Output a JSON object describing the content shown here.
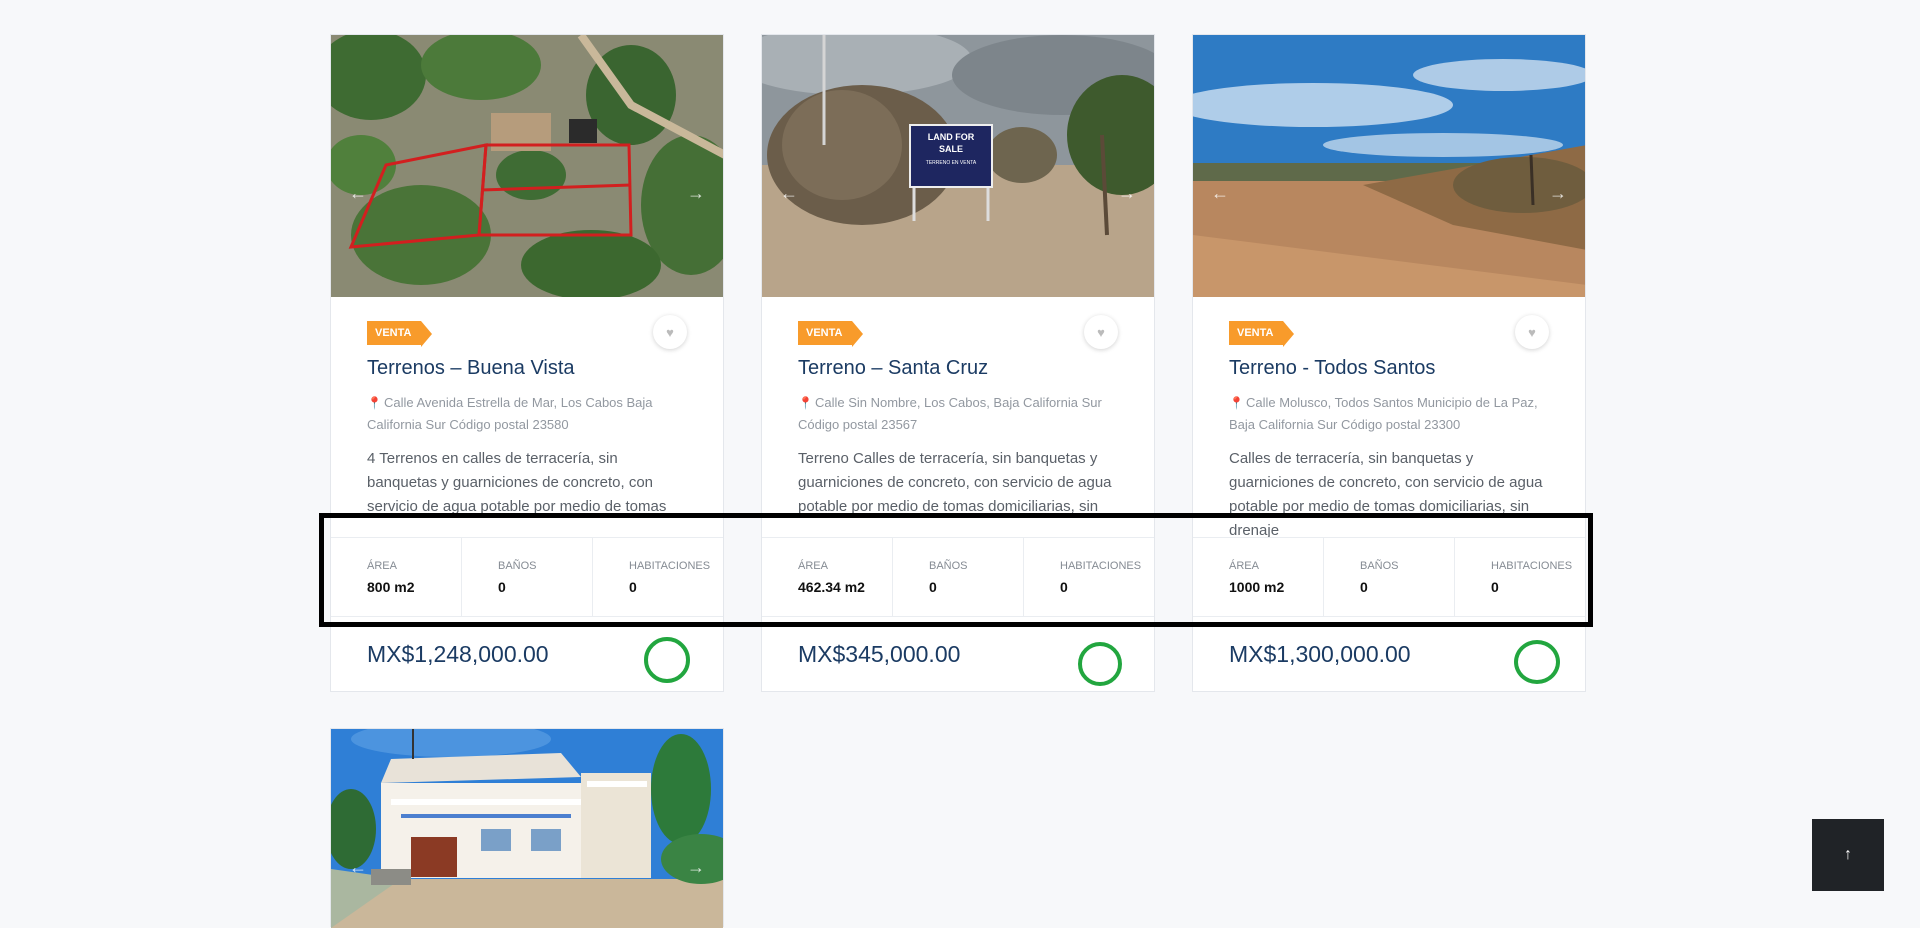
{
  "listings": [
    {
      "badge": "VENTA",
      "title": "Terrenos – Buena Vista",
      "address": "Calle Avenida Estrella de Mar, Los Cabos Baja California Sur Código postal 23580",
      "description": "4 Terrenos en calles de terracería, sin banquetas y guarniciones de concreto, con servicio de agua potable por medio de tomas",
      "stats": [
        {
          "label": "Área",
          "value": "800 m2"
        },
        {
          "label": "Baños",
          "value": "0"
        },
        {
          "label": "Habitaciones",
          "value": "0"
        }
      ],
      "price": "MX$1,248,000.00"
    },
    {
      "badge": "VENTA",
      "title": "Terreno – Santa Cruz",
      "address": "Calle Sin Nombre, Los Cabos, Baja California Sur Código postal 23567",
      "description": "Terreno Calles de terracería, sin banquetas y guarniciones de concreto, con servicio de agua potable por medio de tomas domiciliarias, sin",
      "sign_line1": "LAND FOR",
      "sign_line2": "SALE",
      "sign_line3": "TERRENO EN VENTA",
      "stats": [
        {
          "label": "Área",
          "value": "462.34 m2"
        },
        {
          "label": "Baños",
          "value": "0"
        },
        {
          "label": "Habitaciones",
          "value": "0"
        }
      ],
      "price": "MX$345,000.00"
    },
    {
      "badge": "VENTA",
      "title": "Terreno - Todos Santos",
      "address": "Calle Molusco, Todos Santos Municipio de La Paz, Baja California Sur Código postal 23300",
      "description": "Calles de terracería, sin banquetas y guarniciones de concreto, con servicio de agua potable por medio de tomas domiciliarias, sin drenaje",
      "stats": [
        {
          "label": "Área",
          "value": "1000 m2"
        },
        {
          "label": "Baños",
          "value": "0"
        },
        {
          "label": "Habitaciones",
          "value": "0"
        }
      ],
      "price": "MX$1,300,000.00"
    }
  ],
  "icons": {
    "back_to_top": "arrow-up-icon",
    "favorite": "heart-icon",
    "location": "map-pin-icon"
  },
  "colors": {
    "badge": "#f89b2b",
    "title": "#1b3b63",
    "annotation_circle": "#22a63f",
    "annotation_box": "#000000"
  }
}
